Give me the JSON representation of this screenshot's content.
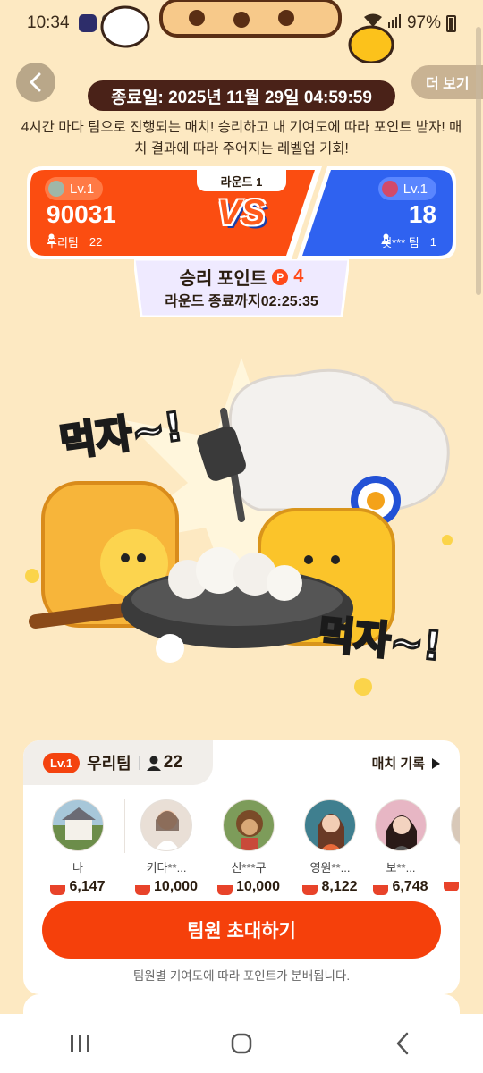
{
  "status": {
    "time": "10:34",
    "battery": "97%"
  },
  "header": {
    "more_label": "더 보기",
    "end_date": "종료일: 2025년 11월 29일 04:59:59"
  },
  "description": "4시간 마다 팀으로 진행되는 매치! 승리하고 내 기여도에 따라 포인트 받자! 매치 결과에 따라 주어지는 레벨업 기회!",
  "match": {
    "round": "라운드 1",
    "vs": "VS",
    "left": {
      "level": "Lv.1",
      "score": "90031",
      "team": "우리팀",
      "members": "22",
      "color": "#fb4d11"
    },
    "right": {
      "level": "Lv.1",
      "score": "18",
      "team": "샛*** 팀",
      "members": "1",
      "color": "#2f62f0"
    }
  },
  "points": {
    "title": "승리 포인트",
    "coin": "P",
    "value": "4",
    "timer": "라운드 종료까지02:25:35"
  },
  "illustration": {
    "shout_left": "먹자~!",
    "shout_right": "먹자~!"
  },
  "team_card": {
    "level": "Lv.1",
    "name": "우리팀",
    "count": "22",
    "history_label": "매치 기록",
    "members": [
      {
        "name": "나",
        "score": "6,147"
      },
      {
        "name": "키다**...",
        "score": "10,000"
      },
      {
        "name": "신***구",
        "score": "10,000"
      },
      {
        "name": "영원**...",
        "score": "8,122"
      },
      {
        "name": "보**...",
        "score": "6,748"
      }
    ],
    "invite_label": "팀원 초대하기",
    "note": "팀원별 기여도에 따라 포인트가 분배됩니다."
  },
  "colors": {
    "accent": "#f5400b",
    "blue": "#2f62f0",
    "background": "#fde9c2"
  }
}
